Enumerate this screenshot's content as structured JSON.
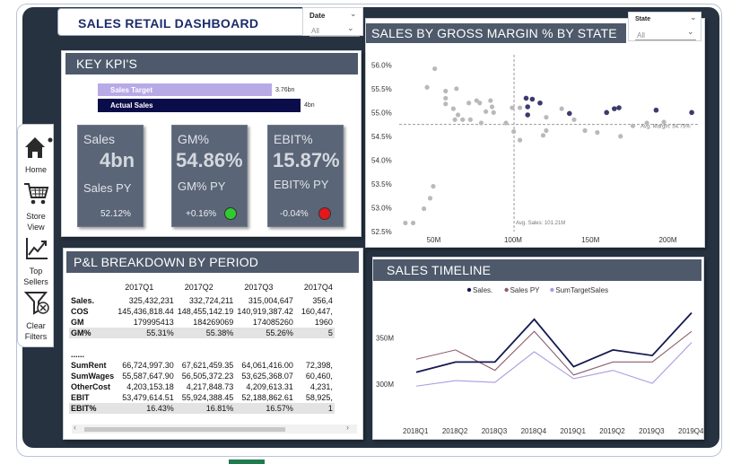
{
  "title": "SALES RETAIL DASHBOARD",
  "date_slicer": {
    "label": "Date",
    "value": "All"
  },
  "state_slicer": {
    "label": "State",
    "value": "All"
  },
  "nav": [
    {
      "label": "Home",
      "icon": "home-icon"
    },
    {
      "label": "Store View",
      "icon": "cart-icon"
    },
    {
      "label": "Top Sellers",
      "icon": "line-chart-icon"
    },
    {
      "label": "Clear Filters",
      "icon": "funnel-clear-icon"
    }
  ],
  "kpi": {
    "header": "KEY KPI'S",
    "target_label": "Sales Target",
    "target_value": "3.76bn",
    "actual_label": "Actual Sales",
    "actual_value": "4bn",
    "target_fraction": 0.94,
    "actual_fraction": 1.0,
    "tiles": [
      {
        "title": "Sales",
        "value": "4bn",
        "sub": "Sales PY",
        "py": "52.12%",
        "indicator": null
      },
      {
        "title": "GM%",
        "value": "54.86%",
        "sub": "GM% PY",
        "py": "+0.16%",
        "indicator": "#2fcc2f"
      },
      {
        "title": "EBIT%",
        "value": "15.87%",
        "sub": "EBIT% PY",
        "py": "-0.04%",
        "indicator": "#e5161c"
      }
    ]
  },
  "scatter_header": "SALES BY GROSS MARGIN % BY STATE",
  "timeline_header": "SALES TIMELINE",
  "pl": {
    "header": "P&L BREAKDOWN BY PERIOD",
    "columns": [
      "",
      "2017Q1",
      "2017Q2",
      "2017Q3",
      "2017Q4"
    ],
    "rows": [
      {
        "label": "Sales.",
        "vals": [
          "325,432,231",
          "332,724,211",
          "315,004,647",
          "356,4"
        ],
        "shade": false
      },
      {
        "label": "COS",
        "vals": [
          "145,436,818.44",
          "148,455,142.19",
          "140,919,387.42",
          "160,447,"
        ],
        "shade": false
      },
      {
        "label": "GM",
        "vals": [
          "179995413",
          "184269069",
          "174085260",
          "1960"
        ],
        "shade": false
      },
      {
        "label": "GM%",
        "vals": [
          "55.31%",
          "55.38%",
          "55.26%",
          "5"
        ],
        "shade": true
      },
      {
        "label": "",
        "vals": [
          "",
          "",
          "",
          ""
        ],
        "shade": false
      },
      {
        "label": "......",
        "vals": [
          "",
          "",
          "",
          ""
        ],
        "shade": false
      },
      {
        "label": "SumRent",
        "vals": [
          "66,724,997.30",
          "67,621,459.35",
          "64,061,416.00",
          "72,398,"
        ],
        "shade": false
      },
      {
        "label": "SumWages",
        "vals": [
          "55,587,647.90",
          "56,505,372.23",
          "53,625,368.07",
          "60,460,"
        ],
        "shade": false
      },
      {
        "label": "OtherCost",
        "vals": [
          "4,203,153.18",
          "4,217,848.73",
          "4,209,613.31",
          "4,231,"
        ],
        "shade": false
      },
      {
        "label": "EBIT",
        "vals": [
          "53,479,614.51",
          "55,924,388.45",
          "52,188,862.61",
          "58,925,"
        ],
        "shade": false
      },
      {
        "label": "EBIT%",
        "vals": [
          "16.43%",
          "16.81%",
          "16.57%",
          "1"
        ],
        "shade": true
      }
    ]
  },
  "chart_data": [
    {
      "type": "scatter",
      "title": "SALES BY GROSS MARGIN % BY STATE",
      "xlabel": "",
      "ylabel": "",
      "xlim": [
        27,
        220
      ],
      "ylim": [
        52.5,
        56.1
      ],
      "x_ticks": [
        "50M",
        "100M",
        "150M",
        "200M"
      ],
      "y_ticks": [
        "52.5%",
        "53.0%",
        "53.5%",
        "54.0%",
        "54.5%",
        "55.0%",
        "55.5%",
        "56.0%"
      ],
      "reference_lines": [
        {
          "axis": "y",
          "value": 54.75,
          "label": "Avg. Margin: 54.75%"
        },
        {
          "axis": "x",
          "value": 101.21,
          "label": "Avg. Sales: 101.21M"
        }
      ],
      "points_gray": [
        [
          36,
          52.68
        ],
        [
          31,
          52.68
        ],
        [
          43,
          52.98
        ],
        [
          47,
          53.2
        ],
        [
          49,
          53.45
        ],
        [
          50,
          55.92
        ],
        [
          45,
          55.53
        ],
        [
          57,
          55.45
        ],
        [
          57,
          55.3
        ],
        [
          57,
          55.18
        ],
        [
          64,
          55.5
        ],
        [
          77,
          55.25
        ],
        [
          72,
          55.2
        ],
        [
          79,
          55.2
        ],
        [
          62,
          55.08
        ],
        [
          63,
          54.85
        ],
        [
          68,
          54.85
        ],
        [
          73,
          54.85
        ],
        [
          65,
          54.95
        ],
        [
          86,
          55.25
        ],
        [
          87,
          55.12
        ],
        [
          88,
          55.0
        ],
        [
          83,
          55.02
        ],
        [
          100,
          55.1
        ],
        [
          105,
          55.1
        ],
        [
          80,
          54.78
        ],
        [
          96,
          54.78
        ],
        [
          101,
          54.6
        ],
        [
          105,
          54.42
        ],
        [
          120,
          54.52
        ],
        [
          122,
          54.62
        ],
        [
          122,
          54.9
        ],
        [
          132,
          55.08
        ],
        [
          140,
          54.85
        ],
        [
          147,
          54.62
        ],
        [
          155,
          54.58
        ],
        [
          170,
          54.5
        ],
        [
          178,
          54.72
        ],
        [
          187,
          54.78
        ],
        [
          198,
          54.8
        ]
      ],
      "points_dark": [
        [
          109,
          55.3
        ],
        [
          113,
          55.28
        ],
        [
          118,
          55.2
        ],
        [
          110,
          55.12
        ],
        [
          110,
          54.95
        ],
        [
          137,
          54.98
        ],
        [
          161,
          55.0
        ],
        [
          166,
          55.08
        ],
        [
          169,
          55.1
        ],
        [
          193,
          55.05
        ],
        [
          216,
          55.0
        ]
      ]
    },
    {
      "type": "line",
      "title": "SALES TIMELINE",
      "categories": [
        "2018Q1",
        "2018Q2",
        "2018Q3",
        "2018Q4",
        "2019Q1",
        "2019Q2",
        "2019Q3",
        "2019Q4"
      ],
      "y_ticks": [
        "300M",
        "350M"
      ],
      "ylim": [
        276,
        392
      ],
      "series": [
        {
          "name": "Sales.",
          "color": "#141852",
          "values": [
            313,
            324,
            324,
            370,
            319,
            337,
            331,
            377
          ]
        },
        {
          "name": "Sales PY",
          "color": "#8c5f6c",
          "values": [
            327,
            337,
            315,
            357,
            310,
            324,
            324,
            357
          ]
        },
        {
          "name": "SumTargetSales",
          "color": "#a99be0",
          "values": [
            298,
            304,
            302,
            335,
            306,
            315,
            301,
            345
          ]
        }
      ]
    }
  ]
}
